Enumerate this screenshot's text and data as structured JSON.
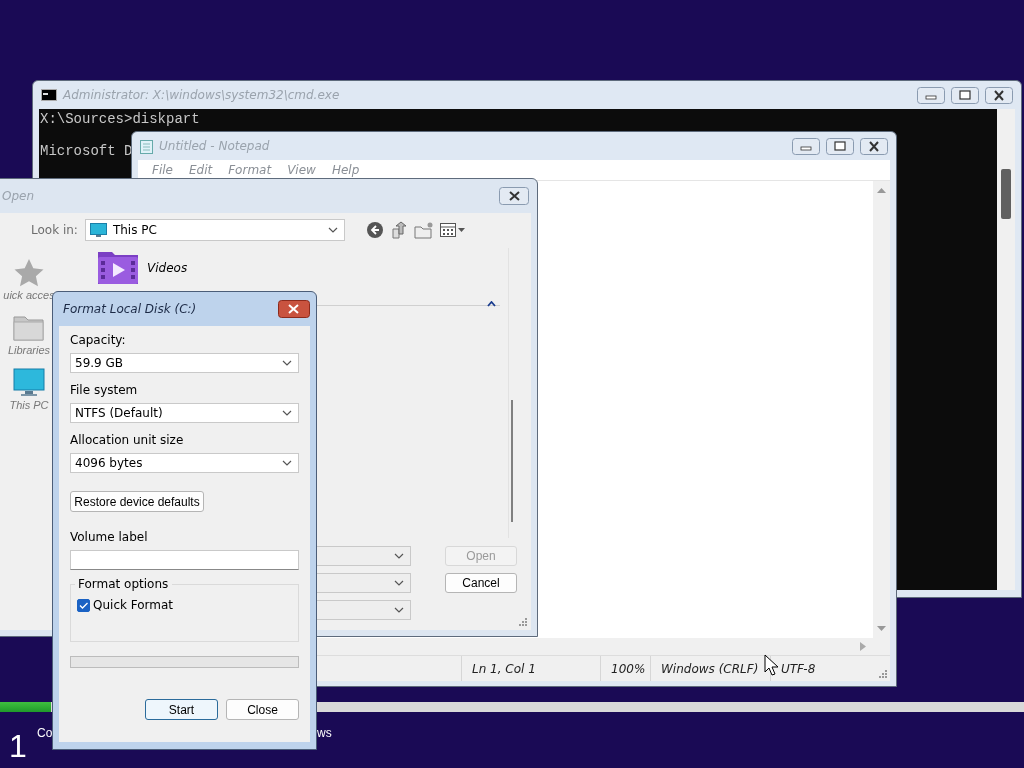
{
  "desktop": {
    "setup_progress": {
      "level": 0.05
    },
    "step_number": "1",
    "step_labels": [
      "Co",
      "ws"
    ]
  },
  "cmd_window": {
    "title": "Administrator: X:\\windows\\system32\\cmd.exe",
    "active": false,
    "lines": [
      "X:\\Sources>diskpart",
      "Microsoft D"
    ]
  },
  "notepad_window": {
    "title": "Untitled - Notepad",
    "active": false,
    "menu": [
      "File",
      "Edit",
      "Format",
      "View",
      "Help"
    ],
    "status_bar": [
      "Ln 1, Col 1",
      "100%",
      "Windows (CRLF)",
      "UTF-8"
    ]
  },
  "open_dialog": {
    "title": "Open",
    "active": false,
    "look_in_label": "Look in:",
    "look_in_value": "This PC",
    "sidebar": [
      {
        "label": "uick acces",
        "kind": "star"
      },
      {
        "label": "Libraries",
        "kind": "folder"
      },
      {
        "label": "This PC",
        "kind": "monitor"
      }
    ],
    "files": [
      {
        "name": "Videos",
        "kind": "videos"
      }
    ],
    "buttons": [
      {
        "label": "Open",
        "disabled": true
      },
      {
        "label": "Cancel",
        "disabled": false
      }
    ]
  },
  "format_dialog": {
    "title": "Format Local Disk (C:)",
    "active": true,
    "fields": [
      {
        "label": "Capacity:",
        "value": "59.9 GB"
      },
      {
        "label": "File system",
        "value": "NTFS (Default)"
      },
      {
        "label": "Allocation unit size",
        "value": "4096 bytes"
      }
    ],
    "restore_button": "Restore device defaults",
    "volume_label": {
      "label": "Volume label"
    },
    "options_group": {
      "title": "Format options",
      "options": [
        {
          "label": "Quick Format",
          "checked": true
        }
      ]
    },
    "progress": {
      "level": 0
    },
    "buttons": [
      {
        "label": "Start",
        "default": true
      },
      {
        "label": "Close",
        "default": false
      }
    ]
  }
}
